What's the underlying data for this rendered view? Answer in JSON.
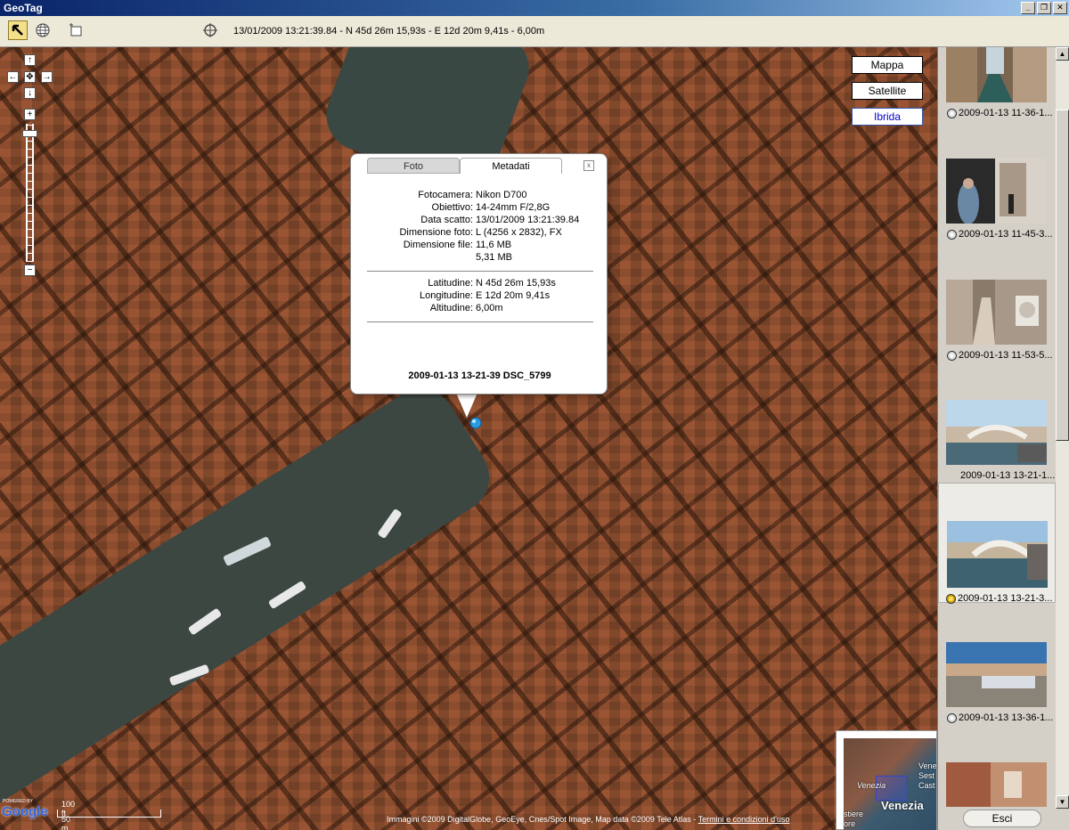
{
  "window": {
    "title": "GeoTag",
    "btn_min": "_",
    "btn_max": "❐",
    "btn_close": "✕"
  },
  "toolbar": {
    "coords": "13/01/2009 13:21:39.84 - N 45d 26m 15,93s - E 12d 20m 9,41s - 6,00m"
  },
  "map": {
    "types": [
      "Mappa",
      "Satellite",
      "Ibrida"
    ],
    "selected_type": "Ibrida",
    "nav": {
      "up": "↑",
      "left": "←",
      "center": "✥",
      "right": "→",
      "down": "↓",
      "zoom_in": "+",
      "zoom_out": "−"
    },
    "scale_ft": "100 ft",
    "scale_m": "50 m",
    "google": "Google",
    "powered_by": "POWERED BY",
    "attribution": "Immagini ©2009 DigitalGlobe, GeoEye, Cnes/Spot Image, Map data ©2009 Tele Atlas -",
    "terms": "Termini e condizioni d'uso",
    "overview": {
      "city": "Venezia",
      "italic": "Venezia",
      "partial1": "Vene",
      "partial2": "Sest",
      "partial3": "Cast",
      "partial4": "stiere",
      "partial5": "ore"
    }
  },
  "infowindow": {
    "tab_photo": "Foto",
    "tab_meta": "Metadati",
    "close": "x",
    "rows_camera": [
      {
        "k": "Fotocamera:",
        "v": "Nikon D700"
      },
      {
        "k": "Obiettivo:",
        "v": "14-24mm F/2,8G"
      },
      {
        "k": "Data scatto:",
        "v": "13/01/2009 13:21:39.84"
      },
      {
        "k": "Dimensione foto:",
        "v": "L (4256 x 2832), FX"
      },
      {
        "k": "Dimensione file:",
        "v": "11,6 MB"
      },
      {
        "k": "",
        "v": "5,31 MB"
      }
    ],
    "rows_geo": [
      {
        "k": "Latitudine:",
        "v": "N 45d 26m 15,93s"
      },
      {
        "k": "Longitudine:",
        "v": "E 12d 20m 9,41s"
      },
      {
        "k": "Altitudine:",
        "v": "6,00m"
      }
    ],
    "photo_name": "2009-01-13 13-21-39 DSC_5799"
  },
  "thumbnails": [
    {
      "caption": "2009-01-13 11-36-1...",
      "globe": "white"
    },
    {
      "caption": "2009-01-13 11-45-3...",
      "globe": "white"
    },
    {
      "caption": "2009-01-13 11-53-5...",
      "globe": "white"
    },
    {
      "caption": "2009-01-13 13-21-1...",
      "globe": "none"
    },
    {
      "caption": "2009-01-13 13-21-3...",
      "globe": "yellow"
    },
    {
      "caption": "2009-01-13 13-36-1...",
      "globe": "white"
    }
  ],
  "footer": {
    "exit": "Esci"
  }
}
